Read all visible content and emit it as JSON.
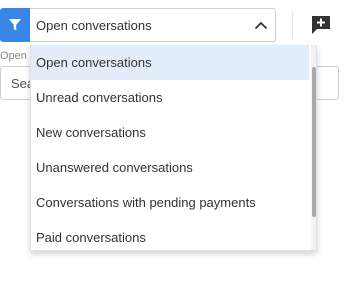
{
  "filter": {
    "icon": "filter-icon",
    "color": "#3a86e8",
    "selected_value": "Open conversations",
    "chevron": "chevron-up-icon"
  },
  "actions": {
    "new_conversation_icon": "add-comment-icon"
  },
  "background": {
    "label": "Open",
    "search_value": "Sea"
  },
  "dropdown": {
    "options": [
      {
        "label": "Open conversations",
        "selected": true
      },
      {
        "label": "Unread conversations",
        "selected": false
      },
      {
        "label": "New conversations",
        "selected": false
      },
      {
        "label": "Unanswered conversations",
        "selected": false
      },
      {
        "label": "Conversations with pending payments",
        "selected": false
      },
      {
        "label": "Paid conversations",
        "selected": false
      }
    ],
    "highlight_color": "#e3ecfb"
  }
}
